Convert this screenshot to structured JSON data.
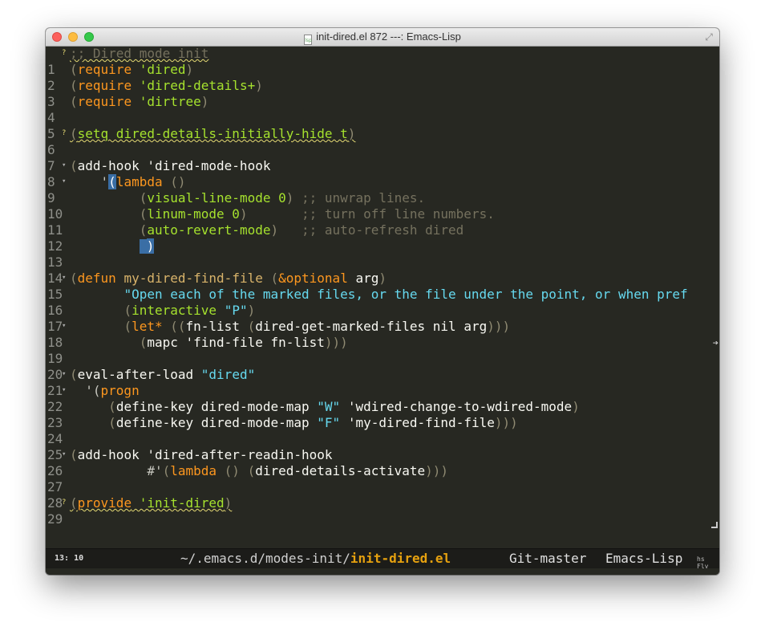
{
  "window": {
    "title": "init-dired.el 872 ---: Emacs-Lisp",
    "doc_icon_label": "lsp"
  },
  "lines": [
    {
      "n": "1",
      "fringe": "?"
    },
    {
      "n": "2"
    },
    {
      "n": "3"
    },
    {
      "n": "4"
    },
    {
      "n": "5"
    },
    {
      "n": "6",
      "fringe": "?"
    },
    {
      "n": "7"
    },
    {
      "n": "8",
      "fringe": "▾"
    },
    {
      "n": "9",
      "fringe": "▾"
    },
    {
      "n": "10"
    },
    {
      "n": "11"
    },
    {
      "n": "12"
    },
    {
      "n": "13"
    },
    {
      "n": "14"
    },
    {
      "n": "15",
      "fringe": "▾"
    },
    {
      "n": "16"
    },
    {
      "n": "17"
    },
    {
      "n": "18",
      "fringe": "▾"
    },
    {
      "n": "19"
    },
    {
      "n": "20"
    },
    {
      "n": "21",
      "fringe": "▾"
    },
    {
      "n": "22",
      "fringe": "▾"
    },
    {
      "n": "23"
    },
    {
      "n": "24"
    },
    {
      "n": "25"
    },
    {
      "n": "26",
      "fringe": "▾"
    },
    {
      "n": "27"
    },
    {
      "n": "28"
    },
    {
      "n": "29",
      "fringe": "?"
    }
  ],
  "code": {
    "l1": ";; Dired mode init",
    "l2_kw": "require",
    "l2_arg": "'dired",
    "l3_kw": "require",
    "l3_arg": "'dired-details+",
    "l4_kw": "require",
    "l4_arg": "'dirtree",
    "l6": "setq dired-details-initially-hide t",
    "l8_fn": "add-hook",
    "l8_arg": " 'dired-mode-hook",
    "l9_q": "'",
    "l9_kw": "lambda",
    "l10_fn": "visual-line-mode 0",
    "l10_cm": ";; unwrap lines.",
    "l11_fn": "linum-mode 0",
    "l11_cm": ";; turn off line numbers.",
    "l12_fn": "auto-revert-mode",
    "l12_cm": ";; auto-refresh dired",
    "l15_kw": "defun",
    "l15_name": "my-dired-find-file",
    "l15_opt": "&optional",
    "l15_arg": "arg",
    "l16_str": "\"Open each of the marked files, or the file under the point, or when pref",
    "l17_fn": "interactive",
    "l17_str": "\"P\"",
    "l18_kw": "let*",
    "l18_var": "fn-list",
    "l18_call": "dired-get-marked-files nil arg",
    "l19_fn": "mapc",
    "l19_arg": " 'find-file fn-list",
    "l21_fn": "eval-after-load",
    "l21_str": "\"dired\"",
    "l22_q": "'(",
    "l22_kw": "progn",
    "l23_fn": "define-key dired-mode-map",
    "l23_str": "\"W\"",
    "l23_arg": "'wdired-change-to-wdired-mode",
    "l24_fn": "define-key dired-mode-map",
    "l24_str": "\"F\"",
    "l24_arg": "'my-dired-find-file",
    "l26_fn": "add-hook",
    "l26_arg": " 'dired-after-readin-hook",
    "l27_q": "#'",
    "l27_kw": "lambda",
    "l27_fn": "dired-details-activate",
    "l29_fn": "provide",
    "l29_arg": " 'init-dired"
  },
  "modeline": {
    "position": "13: 10",
    "path_prefix": "~/.emacs.d/modes-init/",
    "file": "init-dired.el",
    "vc": "Git-master",
    "major_mode": "Emacs-Lisp",
    "minor_modes": "hs Fly"
  }
}
